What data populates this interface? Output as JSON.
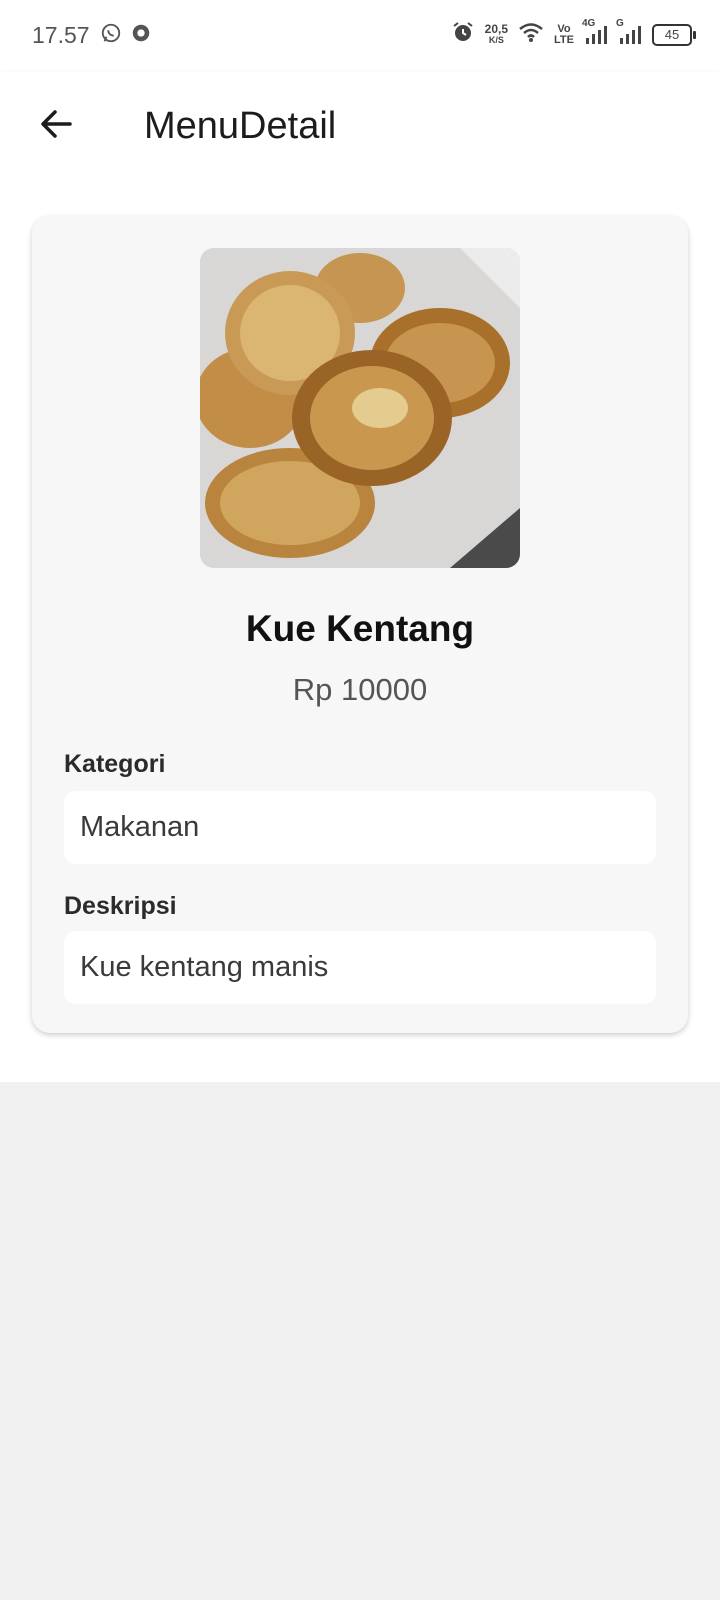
{
  "status_bar": {
    "time": "17.57",
    "net_speed_value": "20,5",
    "net_speed_unit": "K/S",
    "volte_top": "Vo",
    "volte_bottom": "LTE",
    "network_1": "4G",
    "network_2": "G",
    "battery": "45",
    "icons": [
      "whatsapp-icon",
      "notification-app-icon",
      "alarm-icon",
      "wifi-icon",
      "signal-icon",
      "battery-icon"
    ]
  },
  "app_bar": {
    "title": "MenuDetail",
    "back_icon": "arrow-left-icon"
  },
  "menu": {
    "name": "Kue Kentang",
    "price": "Rp 10000",
    "category_label": "Kategori",
    "category_value": "Makanan",
    "description_label": "Deskripsi",
    "description_value": "Kue kentang manis"
  },
  "colors": {
    "app_bar_bg": "#ffffff",
    "card_bg": "#f7f7f7",
    "page_bg": "#f0f0f0",
    "field_bg": "#ffffff",
    "title_text": "#1c1c1c"
  }
}
